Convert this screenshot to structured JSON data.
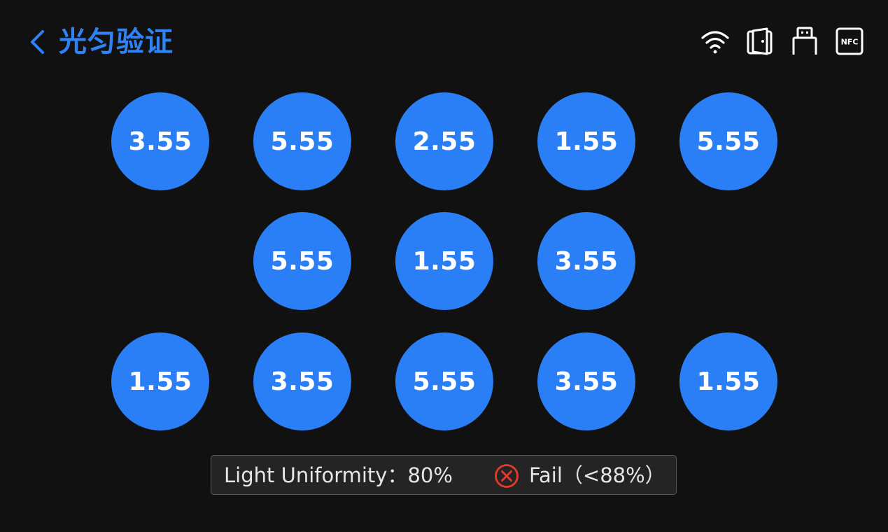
{
  "header": {
    "title": "光匀验证",
    "back_icon": "chevron-left-icon",
    "status_icons": [
      "wifi-icon",
      "door-icon",
      "usb-icon",
      "nfc-icon"
    ],
    "nfc_label": "NFC",
    "accent_color": "#2f83f7"
  },
  "grid": {
    "row1": [
      "3.55",
      "5.55",
      "2.55",
      "1.55",
      "5.55"
    ],
    "row2": [
      "5.55",
      "1.55",
      "3.55"
    ],
    "row3": [
      "1.55",
      "3.55",
      "5.55",
      "3.55",
      "1.55"
    ],
    "circle_color": "#2a7ff6"
  },
  "result": {
    "label": "Light Uniformity：80%",
    "status": "Fail（<88%）",
    "status_icon": "fail-circle-x-icon",
    "status_color": "#e8392f"
  }
}
